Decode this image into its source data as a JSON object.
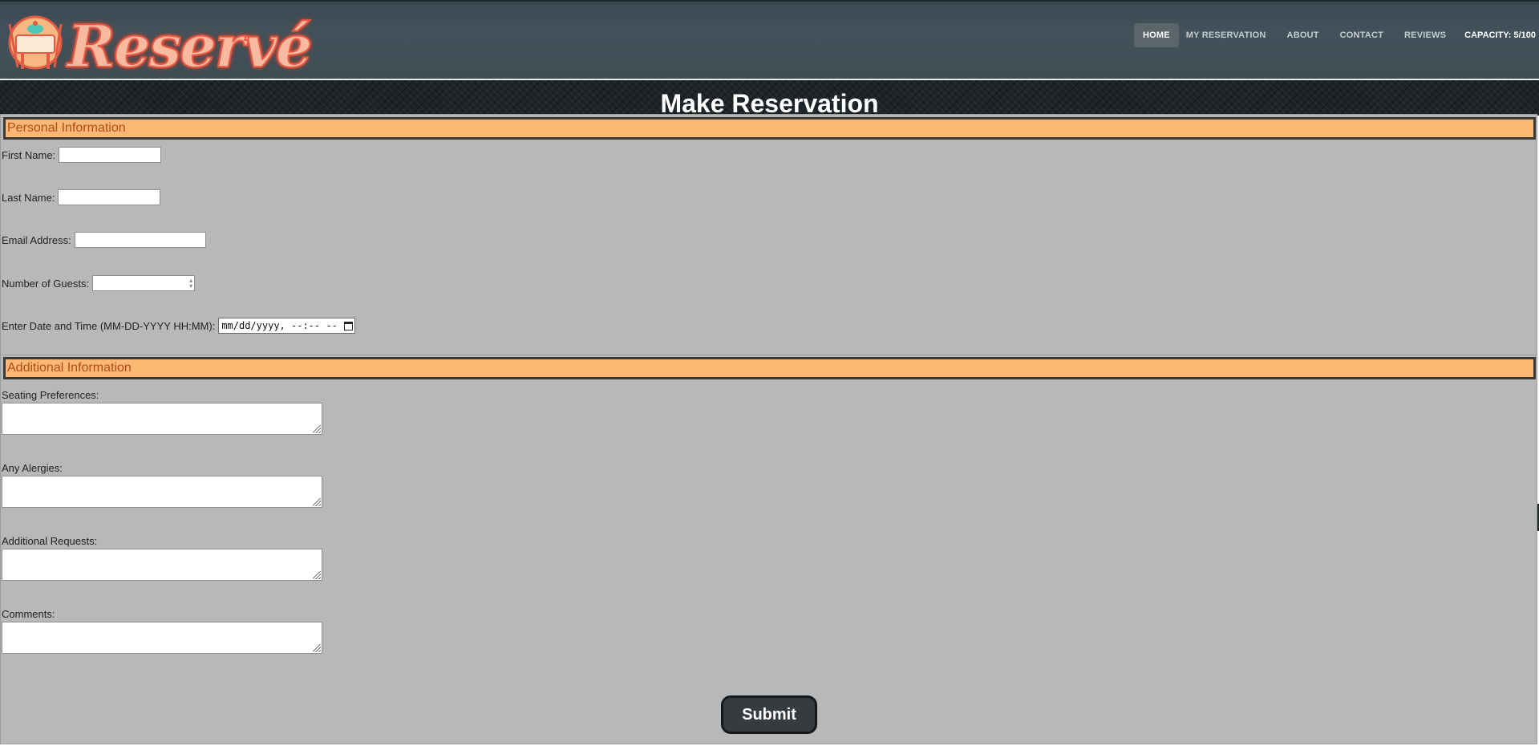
{
  "brand": {
    "name": "Reservé"
  },
  "nav": {
    "items": [
      {
        "label": "HOME",
        "active": true
      },
      {
        "label": "MY RESERVATION",
        "active": false
      },
      {
        "label": "ABOUT",
        "active": false
      },
      {
        "label": "CONTACT",
        "active": false
      },
      {
        "label": "REVIEWS",
        "active": false
      }
    ],
    "capacity": "CAPACITY: 5/100"
  },
  "page": {
    "title": "Make Reservation"
  },
  "personal": {
    "legend": "Personal Information",
    "first_name_label": "First Name:",
    "first_name_value": "",
    "last_name_label": "Last Name:",
    "last_name_value": "",
    "email_label": "Email Address:",
    "email_value": "",
    "guests_label": "Number of Guests:",
    "guests_value": "",
    "datetime_label": "Enter Date and Time (MM-DD-YYYY HH:MM):",
    "datetime_placeholder": "mm/dd/yyyy, --:-- --"
  },
  "additional": {
    "legend": "Additional Information",
    "seating_label": "Seating Preferences:",
    "seating_value": "",
    "allergies_label": "Any Alergies:",
    "allergies_value": "",
    "requests_label": "Additional Requests:",
    "requests_value": "",
    "comments_label": "Comments:",
    "comments_value": ""
  },
  "form": {
    "submit_label": "Submit"
  },
  "colors": {
    "header_bg": "#3f4d55",
    "legend_bg": "#fdb973",
    "legend_text": "#b24a1d",
    "form_bg": "#b8b8b8",
    "submit_bg": "#363b40"
  },
  "icons": {
    "logo": "restaurant-table-icon",
    "calendar": "calendar-icon",
    "spinner": "spinner-arrows-icon",
    "resize": "resize-grip-icon"
  }
}
